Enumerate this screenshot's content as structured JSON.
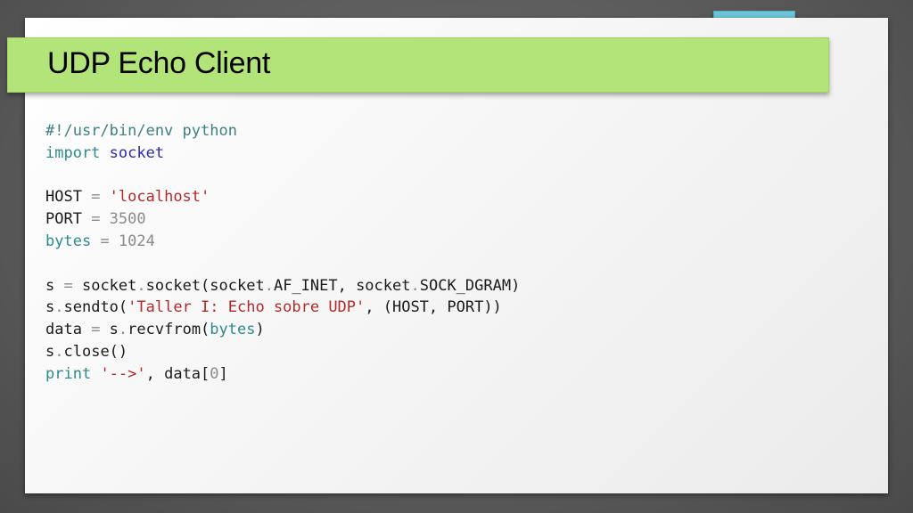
{
  "slide": {
    "title": "UDP Echo Client"
  },
  "colors": {
    "title_bar": "#b2e47a",
    "accent_tab": "#6cc6d6",
    "background": "#5f5f5f",
    "paper": "#f4f4f4"
  },
  "code": {
    "language": "python",
    "lines": [
      [
        {
          "t": "#!/usr/bin/env python",
          "c": "comment"
        }
      ],
      [
        {
          "t": "import",
          "c": "keyword"
        },
        {
          "t": " ",
          "c": "plain"
        },
        {
          "t": "socket",
          "c": "builtin"
        }
      ],
      [],
      [
        {
          "t": "HOST",
          "c": "plain"
        },
        {
          "t": " = ",
          "c": "op"
        },
        {
          "t": "'localhost'",
          "c": "string"
        }
      ],
      [
        {
          "t": "PORT",
          "c": "plain"
        },
        {
          "t": " = ",
          "c": "op"
        },
        {
          "t": "3500",
          "c": "number"
        }
      ],
      [
        {
          "t": "bytes",
          "c": "keyword"
        },
        {
          "t": " = ",
          "c": "op"
        },
        {
          "t": "1024",
          "c": "number"
        }
      ],
      [],
      [
        {
          "t": "s",
          "c": "plain"
        },
        {
          "t": " = ",
          "c": "op"
        },
        {
          "t": "socket",
          "c": "plain"
        },
        {
          "t": ".",
          "c": "op"
        },
        {
          "t": "socket(socket",
          "c": "plain"
        },
        {
          "t": ".",
          "c": "op"
        },
        {
          "t": "AF_INET, socket",
          "c": "plain"
        },
        {
          "t": ".",
          "c": "op"
        },
        {
          "t": "SOCK_DGRAM)",
          "c": "plain"
        }
      ],
      [
        {
          "t": "s",
          "c": "plain"
        },
        {
          "t": ".",
          "c": "op"
        },
        {
          "t": "sendto(",
          "c": "plain"
        },
        {
          "t": "'Taller I: Echo sobre UDP'",
          "c": "string"
        },
        {
          "t": ", (HOST, PORT))",
          "c": "plain"
        }
      ],
      [
        {
          "t": "data",
          "c": "plain"
        },
        {
          "t": " = ",
          "c": "op"
        },
        {
          "t": "s",
          "c": "plain"
        },
        {
          "t": ".",
          "c": "op"
        },
        {
          "t": "recvfrom(",
          "c": "plain"
        },
        {
          "t": "bytes",
          "c": "keyword"
        },
        {
          "t": ")",
          "c": "plain"
        }
      ],
      [
        {
          "t": "s",
          "c": "plain"
        },
        {
          "t": ".",
          "c": "op"
        },
        {
          "t": "close()",
          "c": "plain"
        }
      ],
      [
        {
          "t": "print",
          "c": "keyword"
        },
        {
          "t": " ",
          "c": "plain"
        },
        {
          "t": "'-->'",
          "c": "string"
        },
        {
          "t": ", data[",
          "c": "plain"
        },
        {
          "t": "0",
          "c": "number"
        },
        {
          "t": "]",
          "c": "plain"
        }
      ]
    ]
  }
}
